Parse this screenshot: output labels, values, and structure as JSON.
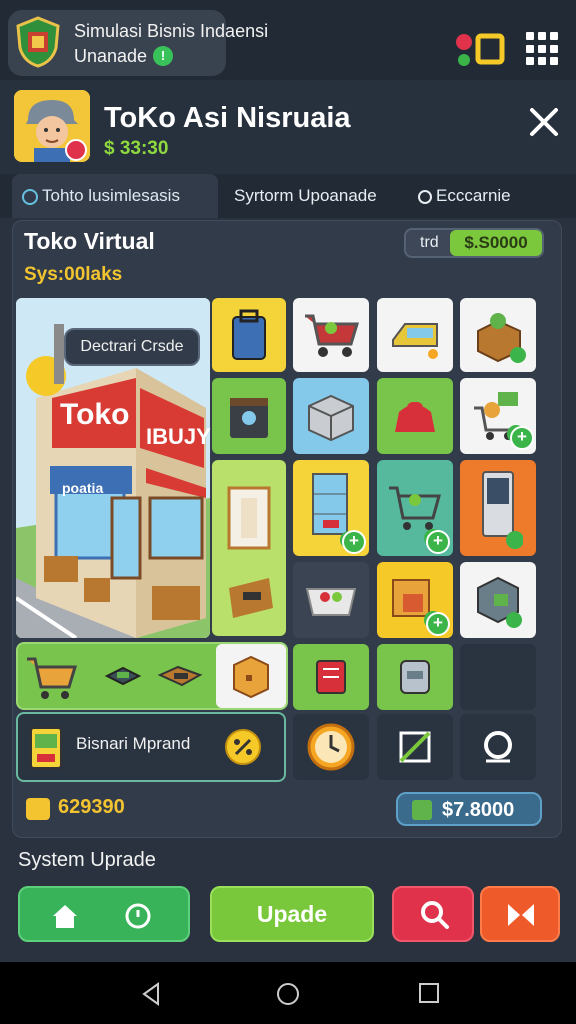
{
  "app": {
    "title": "Simulasi Bisnis Indaensi",
    "subtitle": "Unanade"
  },
  "shop": {
    "title": "ToKo Asi Nisruaia",
    "money": "$ 33:30"
  },
  "tabs": [
    {
      "label": "Tohto lusimlesasis"
    },
    {
      "label": "Syrtorm Upoanade"
    },
    {
      "label": "Ecccarnie"
    }
  ],
  "panel": {
    "title": "Toko Virtual",
    "subtitle": "Sys:00laks",
    "price_label": "trd",
    "price_value": "$.S0000",
    "decor_button": "Dectrari Crsde",
    "upgrade_label": "Bisnari Mprand",
    "coins": "629390",
    "cash": "$7.8000"
  },
  "store_sign": {
    "main": "Toko",
    "side": "IBUJY",
    "awning": "poatia"
  },
  "footer": {
    "section_label": "System Uprade",
    "update_button": "Upade"
  },
  "colors": {
    "tile_yellow": "#f5d43a",
    "tile_green": "#79c44a",
    "tile_blue": "#84c9ea",
    "tile_teal": "#56b89c",
    "tile_orange": "#ee7b2c",
    "tile_white": "#f4f4f4",
    "tile_dark": "#3a4453",
    "accent_green": "#79c83b",
    "accent_red": "#e0334b"
  },
  "icons": [
    "shield-logo-icon",
    "gift-icon",
    "grid-menu-icon",
    "close-icon",
    "home-icon",
    "clock-icon",
    "search-icon",
    "next-icon",
    "back-icon",
    "circle-home-icon",
    "square-recents-icon"
  ]
}
